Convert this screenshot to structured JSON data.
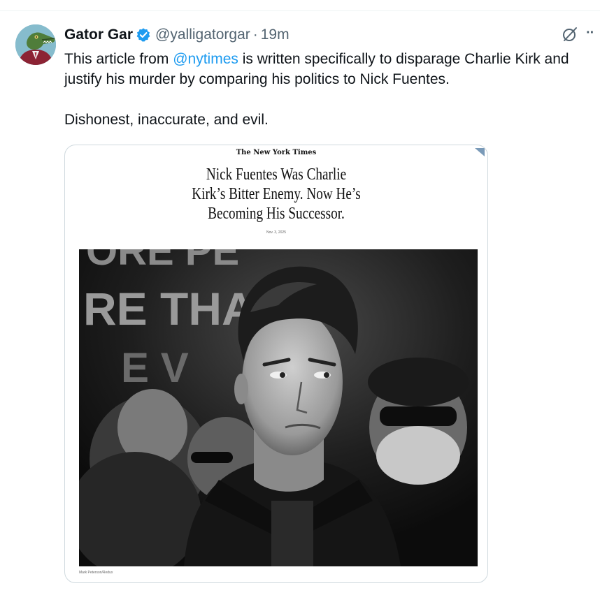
{
  "author": {
    "display_name": "Gator Gar",
    "handle": "@yalligatorgar",
    "separator": "·",
    "time": "19m",
    "avatar_icon": "gator-avatar-icon",
    "verified_icon": "verified-badge-icon"
  },
  "tweet": {
    "line1_before": "This article from ",
    "mention": "@nytimes",
    "line1_after": " is written specifically to disparage Charlie Kirk and justify his murder by comparing his politics to Nick Fuentes.",
    "line2": "Dishonest, inaccurate, and evil."
  },
  "actions": {
    "grok_icon": "grok-icon",
    "more_label": "··"
  },
  "media": {
    "publication": "The New York Times",
    "headline_lines": [
      "Nick Fuentes Was Charlie",
      "Kirk’s Bitter Enemy. Now He’s",
      "Becoming His Successor."
    ],
    "date": "Nov. 3, 2025",
    "photo_bg_text": [
      "ORE PE",
      "RE THA",
      "E V"
    ],
    "photo_credit": "Mark Peterson/Redux"
  },
  "colors": {
    "text": "#0f1419",
    "secondary": "#536471",
    "accent": "#1d9bf0",
    "border": "#cfd9de"
  }
}
